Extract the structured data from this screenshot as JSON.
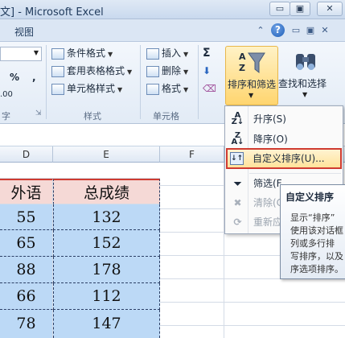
{
  "window": {
    "title": "文] - Microsoft Excel",
    "minimize_glyph": "▭",
    "restore_glyph": "▣",
    "close_glyph": "✕"
  },
  "ribbon_tabs": {
    "view_tab": "视图",
    "help_glyph": "?"
  },
  "ribbon": {
    "number_group": {
      "percent": "%",
      "comma": ",",
      "decimal": ".00",
      "label_fragment": "字"
    },
    "styles_group": {
      "conditional_format": "条件格式",
      "format_as_table": "套用表格格式",
      "cell_styles": "单元格样式",
      "label": "样式"
    },
    "cells_group": {
      "insert": "插入",
      "delete": "删除",
      "format": "格式",
      "label": "单元格"
    },
    "editing_group": {
      "sigma": "Σ",
      "sort_filter": "排序和筛选",
      "find_select": "查找和选择"
    }
  },
  "grid": {
    "columns": [
      "D",
      "E",
      "F"
    ],
    "header_row": {
      "d": "外语",
      "e": "总成绩"
    },
    "rows": [
      {
        "d": "55",
        "e": "132"
      },
      {
        "d": "65",
        "e": "152"
      },
      {
        "d": "88",
        "e": "178"
      },
      {
        "d": "66",
        "e": "112"
      },
      {
        "d": "78",
        "e": "147"
      }
    ]
  },
  "sort_menu": {
    "ascending": "升序(S)",
    "descending": "降序(O)",
    "custom_sort": "自定义排序(U)...",
    "filter": "筛选(F",
    "clear": "清除(C",
    "reapply": "重新应"
  },
  "tooltip": {
    "title": "自定义排序",
    "lines": [
      "显示“排序”",
      "使用该对话框",
      "列或多行排",
      "写排序，以及",
      "序选项排序。"
    ]
  },
  "colors": {
    "highlight_border": "#cf3b31",
    "selection_fill": "#bcd9f6",
    "header_fill": "#f5d9d6",
    "active_button": "#ffd56f"
  }
}
